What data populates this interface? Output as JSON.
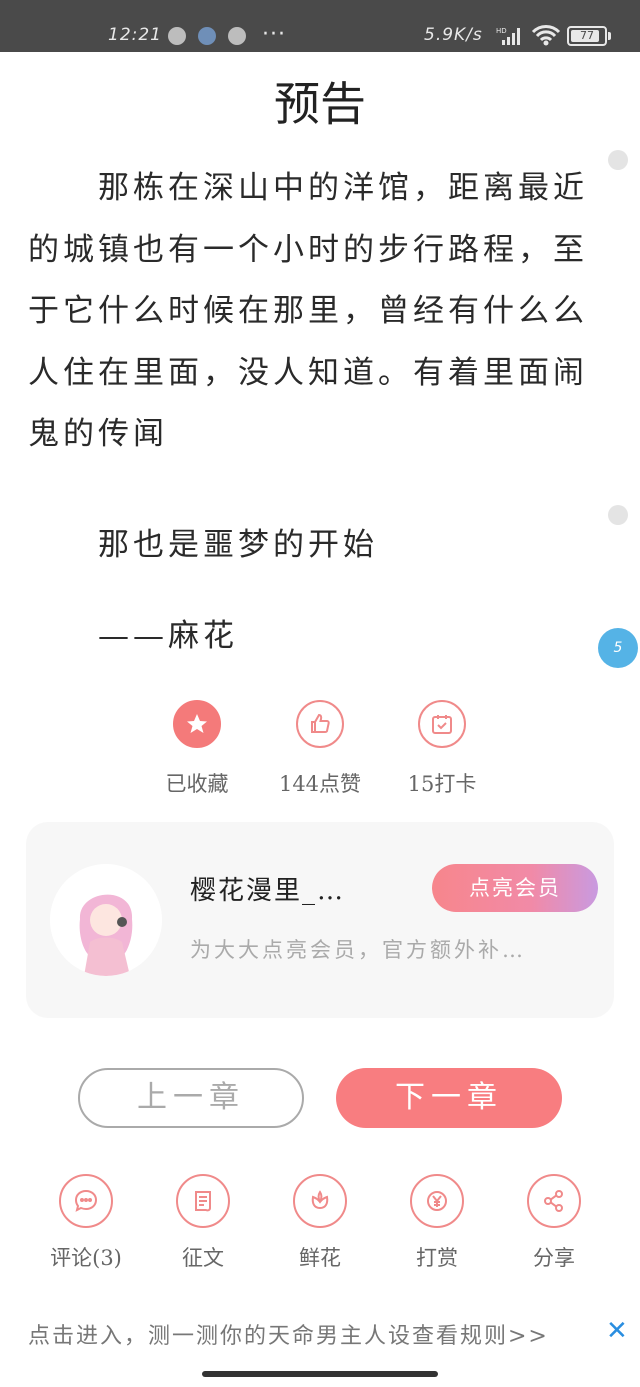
{
  "status_bar": {
    "time": "12:21",
    "more": "···",
    "net_speed": "5.9K/s",
    "signal_label": "HD",
    "battery": "77",
    "battery_level": 0.77
  },
  "chapter": {
    "title": "预告",
    "paragraphs": [
      "那栋在深山中的洋馆，距离最近的城镇也有一个小时的步行路程，至于它什么时候在那里，曾经有什么么人住在里面，没人知道。有着里面闹鬼的传闻",
      "那也是噩梦的开始",
      "——麻花"
    ]
  },
  "comment_bubble": {
    "count": "5"
  },
  "actions": {
    "collect_label": "已收藏",
    "like_label": "144点赞",
    "checkin_label": "15打卡"
  },
  "member_card": {
    "author_name": "樱花漫里_…",
    "button_label": "点亮会员",
    "description": "为大大点亮会员，官方额外补…"
  },
  "nav": {
    "prev_label": "上一章",
    "next_label": "下一章"
  },
  "toolbar": {
    "comment_label": "评论(3)",
    "essay_label": "征文",
    "flower_label": "鲜花",
    "reward_label": "打赏",
    "share_label": "分享"
  },
  "banner": {
    "text": "点击进入，测一测你的天命男主人设查看规则>>",
    "close": "✕"
  },
  "colors": {
    "accent": "#f87d80",
    "status_bar": "#4a4a4a",
    "bubble": "#55b3e6",
    "close": "#2a8ee0"
  }
}
